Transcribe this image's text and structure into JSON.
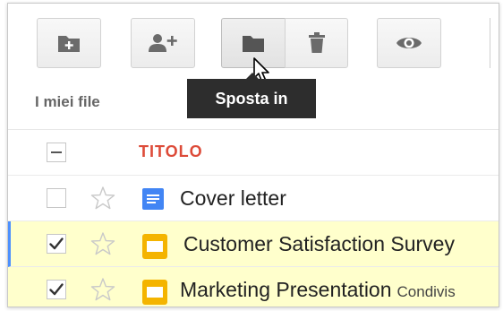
{
  "toolbar": {
    "buttons": [
      {
        "name": "new-folder",
        "icon": "folder-plus-icon"
      },
      {
        "name": "share",
        "icon": "person-plus-icon"
      },
      {
        "name": "move-to",
        "icon": "folder-icon"
      },
      {
        "name": "delete",
        "icon": "trash-icon"
      },
      {
        "name": "preview",
        "icon": "eye-icon"
      }
    ],
    "tooltip": "Sposta in"
  },
  "breadcrumb": "I miei file",
  "list": {
    "column_title": "TITOLO",
    "files": [
      {
        "name": "Cover letter",
        "type": "document",
        "icon": "doc-icon",
        "checked": false,
        "starred": false,
        "selected": false,
        "shared_label": ""
      },
      {
        "name": "Customer Satisfaction Survey",
        "type": "presentation",
        "icon": "slides-icon",
        "checked": true,
        "starred": false,
        "selected": true,
        "shared_label": ""
      },
      {
        "name": "Marketing Presentation",
        "type": "presentation",
        "icon": "slides-icon",
        "checked": true,
        "starred": false,
        "selected": true,
        "shared_label": "Condivis"
      }
    ]
  },
  "colors": {
    "accent_red": "#dd4b39",
    "selection_yellow": "#ffffcc",
    "doc_blue": "#4285f4",
    "slides_yellow": "#f4b400",
    "focus_blue": "#4d90fe"
  }
}
